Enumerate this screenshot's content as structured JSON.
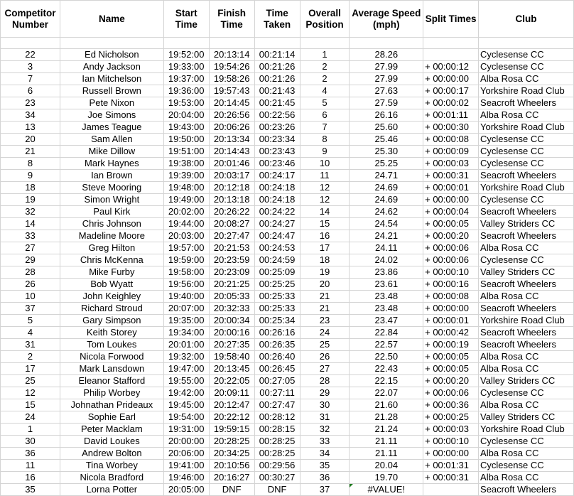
{
  "headers": [
    "Competitor Number",
    "Name",
    "Start Time",
    "Finish Time",
    "Time Taken",
    "Overall Position",
    "Average Speed (mph)",
    "Split Times",
    "Club"
  ],
  "rows": [
    {
      "number": "22",
      "name": "Ed Nicholson",
      "start": "19:52:00",
      "finish": "20:13:14",
      "taken": "00:21:14",
      "position": "1",
      "speed": "28.26",
      "split": "",
      "club": "Cyclesense CC"
    },
    {
      "number": "3",
      "name": "Andy Jackson",
      "start": "19:33:00",
      "finish": "19:54:26",
      "taken": "00:21:26",
      "position": "2",
      "speed": "27.99",
      "split": "+ 00:00:12",
      "club": "Cyclesense CC"
    },
    {
      "number": "7",
      "name": "Ian Mitchelson",
      "start": "19:37:00",
      "finish": "19:58:26",
      "taken": "00:21:26",
      "position": "2",
      "speed": "27.99",
      "split": "+ 00:00:00",
      "club": "Alba Rosa CC"
    },
    {
      "number": "6",
      "name": "Russell Brown",
      "start": "19:36:00",
      "finish": "19:57:43",
      "taken": "00:21:43",
      "position": "4",
      "speed": "27.63",
      "split": "+ 00:00:17",
      "club": "Yorkshire Road Club"
    },
    {
      "number": "23",
      "name": "Pete Nixon",
      "start": "19:53:00",
      "finish": "20:14:45",
      "taken": "00:21:45",
      "position": "5",
      "speed": "27.59",
      "split": "+ 00:00:02",
      "club": "Seacroft Wheelers"
    },
    {
      "number": "34",
      "name": "Joe Simons",
      "start": "20:04:00",
      "finish": "20:26:56",
      "taken": "00:22:56",
      "position": "6",
      "speed": "26.16",
      "split": "+ 00:01:11",
      "club": "Alba Rosa CC"
    },
    {
      "number": "13",
      "name": "James Teague",
      "start": "19:43:00",
      "finish": "20:06:26",
      "taken": "00:23:26",
      "position": "7",
      "speed": "25.60",
      "split": "+ 00:00:30",
      "club": "Yorkshire Road Club"
    },
    {
      "number": "20",
      "name": "Sam Allen",
      "start": "19:50:00",
      "finish": "20:13:34",
      "taken": "00:23:34",
      "position": "8",
      "speed": "25.46",
      "split": "+ 00:00:08",
      "club": "Cyclesense CC"
    },
    {
      "number": "21",
      "name": "Mike Dillow",
      "start": "19:51:00",
      "finish": "20:14:43",
      "taken": "00:23:43",
      "position": "9",
      "speed": "25.30",
      "split": "+ 00:00:09",
      "club": "Cyclesense CC"
    },
    {
      "number": "8",
      "name": "Mark Haynes",
      "start": "19:38:00",
      "finish": "20:01:46",
      "taken": "00:23:46",
      "position": "10",
      "speed": "25.25",
      "split": "+ 00:00:03",
      "club": "Cyclesense CC"
    },
    {
      "number": "9",
      "name": "Ian Brown",
      "start": "19:39:00",
      "finish": "20:03:17",
      "taken": "00:24:17",
      "position": "11",
      "speed": "24.71",
      "split": "+ 00:00:31",
      "club": "Seacroft Wheelers"
    },
    {
      "number": "18",
      "name": "Steve Mooring",
      "start": "19:48:00",
      "finish": "20:12:18",
      "taken": "00:24:18",
      "position": "12",
      "speed": "24.69",
      "split": "+ 00:00:01",
      "club": "Yorkshire Road Club"
    },
    {
      "number": "19",
      "name": "Simon Wright",
      "start": "19:49:00",
      "finish": "20:13:18",
      "taken": "00:24:18",
      "position": "12",
      "speed": "24.69",
      "split": "+ 00:00:00",
      "club": "Cyclesense CC"
    },
    {
      "number": "32",
      "name": "Paul Kirk",
      "start": "20:02:00",
      "finish": "20:26:22",
      "taken": "00:24:22",
      "position": "14",
      "speed": "24.62",
      "split": "+ 00:00:04",
      "club": "Seacroft Wheelers"
    },
    {
      "number": "14",
      "name": "Chris Johnson",
      "start": "19:44:00",
      "finish": "20:08:27",
      "taken": "00:24:27",
      "position": "15",
      "speed": "24.54",
      "split": "+ 00:00:05",
      "club": "Valley Striders CC"
    },
    {
      "number": "33",
      "name": "Madeline Moore",
      "start": "20:03:00",
      "finish": "20:27:47",
      "taken": "00:24:47",
      "position": "16",
      "speed": "24.21",
      "split": "+ 00:00:20",
      "club": "Seacroft Wheelers"
    },
    {
      "number": "27",
      "name": "Greg Hilton",
      "start": "19:57:00",
      "finish": "20:21:53",
      "taken": "00:24:53",
      "position": "17",
      "speed": "24.11",
      "split": "+ 00:00:06",
      "club": "Alba Rosa CC"
    },
    {
      "number": "29",
      "name": "Chris McKenna",
      "start": "19:59:00",
      "finish": "20:23:59",
      "taken": "00:24:59",
      "position": "18",
      "speed": "24.02",
      "split": "+ 00:00:06",
      "club": "Cyclesense CC"
    },
    {
      "number": "28",
      "name": "Mike Furby",
      "start": "19:58:00",
      "finish": "20:23:09",
      "taken": "00:25:09",
      "position": "19",
      "speed": "23.86",
      "split": "+ 00:00:10",
      "club": "Valley Striders CC"
    },
    {
      "number": "26",
      "name": "Bob Wyatt",
      "start": "19:56:00",
      "finish": "20:21:25",
      "taken": "00:25:25",
      "position": "20",
      "speed": "23.61",
      "split": "+ 00:00:16",
      "club": "Seacroft Wheelers"
    },
    {
      "number": "10",
      "name": "John Keighley",
      "start": "19:40:00",
      "finish": "20:05:33",
      "taken": "00:25:33",
      "position": "21",
      "speed": "23.48",
      "split": "+ 00:00:08",
      "club": "Alba Rosa CC"
    },
    {
      "number": "37",
      "name": "Richard Stroud",
      "start": "20:07:00",
      "finish": "20:32:33",
      "taken": "00:25:33",
      "position": "21",
      "speed": "23.48",
      "split": "+ 00:00:00",
      "club": "Seacroft Wheelers"
    },
    {
      "number": "5",
      "name": "Gary Simpson",
      "start": "19:35:00",
      "finish": "20:00:34",
      "taken": "00:25:34",
      "position": "23",
      "speed": "23.47",
      "split": "+ 00:00:01",
      "club": "Yorkshire Road Club"
    },
    {
      "number": "4",
      "name": "Keith Storey",
      "start": "19:34:00",
      "finish": "20:00:16",
      "taken": "00:26:16",
      "position": "24",
      "speed": "22.84",
      "split": "+ 00:00:42",
      "club": "Seacroft Wheelers"
    },
    {
      "number": "31",
      "name": "Tom Loukes",
      "start": "20:01:00",
      "finish": "20:27:35",
      "taken": "00:26:35",
      "position": "25",
      "speed": "22.57",
      "split": "+ 00:00:19",
      "club": "Seacroft Wheelers"
    },
    {
      "number": "2",
      "name": "Nicola Forwood",
      "start": "19:32:00",
      "finish": "19:58:40",
      "taken": "00:26:40",
      "position": "26",
      "speed": "22.50",
      "split": "+ 00:00:05",
      "club": "Alba Rosa CC"
    },
    {
      "number": "17",
      "name": "Mark Lansdown",
      "start": "19:47:00",
      "finish": "20:13:45",
      "taken": "00:26:45",
      "position": "27",
      "speed": "22.43",
      "split": "+ 00:00:05",
      "club": "Alba Rosa CC"
    },
    {
      "number": "25",
      "name": "Eleanor Stafford",
      "start": "19:55:00",
      "finish": "20:22:05",
      "taken": "00:27:05",
      "position": "28",
      "speed": "22.15",
      "split": "+ 00:00:20",
      "club": "Valley Striders CC"
    },
    {
      "number": "12",
      "name": "Philip Worbey",
      "start": "19:42:00",
      "finish": "20:09:11",
      "taken": "00:27:11",
      "position": "29",
      "speed": "22.07",
      "split": "+ 00:00:06",
      "club": "Cyclesense CC"
    },
    {
      "number": "15",
      "name": "Johnathan Prideaux",
      "start": "19:45:00",
      "finish": "20:12:47",
      "taken": "00:27:47",
      "position": "30",
      "speed": "21.60",
      "split": "+ 00:00:36",
      "club": "Alba Rosa CC"
    },
    {
      "number": "24",
      "name": "Sophie Earl",
      "start": "19:54:00",
      "finish": "20:22:12",
      "taken": "00:28:12",
      "position": "31",
      "speed": "21.28",
      "split": "+ 00:00:25",
      "club": "Valley Striders CC"
    },
    {
      "number": "1",
      "name": "Peter Macklam",
      "start": "19:31:00",
      "finish": "19:59:15",
      "taken": "00:28:15",
      "position": "32",
      "speed": "21.24",
      "split": "+ 00:00:03",
      "club": "Yorkshire Road Club"
    },
    {
      "number": "30",
      "name": "David Loukes",
      "start": "20:00:00",
      "finish": "20:28:25",
      "taken": "00:28:25",
      "position": "33",
      "speed": "21.11",
      "split": "+ 00:00:10",
      "club": "Cyclesense CC"
    },
    {
      "number": "36",
      "name": "Andrew Bolton",
      "start": "20:06:00",
      "finish": "20:34:25",
      "taken": "00:28:25",
      "position": "34",
      "speed": "21.11",
      "split": "+ 00:00:00",
      "club": "Alba Rosa CC"
    },
    {
      "number": "11",
      "name": "Tina Worbey",
      "start": "19:41:00",
      "finish": "20:10:56",
      "taken": "00:29:56",
      "position": "35",
      "speed": "20.04",
      "split": "+ 00:01:31",
      "club": "Cyclesense CC"
    },
    {
      "number": "16",
      "name": "Nicola Bradford",
      "start": "19:46:00",
      "finish": "20:16:27",
      "taken": "00:30:27",
      "position": "36",
      "speed": "19.70",
      "split": "+ 00:00:31",
      "club": "Alba Rosa CC"
    },
    {
      "number": "35",
      "name": "Lorna Potter",
      "start": "20:05:00",
      "finish": "DNF",
      "taken": "DNF",
      "position": "37",
      "speed": "#VALUE!",
      "split": "",
      "club": "Seacroft Wheelers",
      "speed_error": true
    }
  ],
  "colors": {
    "gridline": "#d4d4d4",
    "error_indicator": "#1e7b1e"
  }
}
